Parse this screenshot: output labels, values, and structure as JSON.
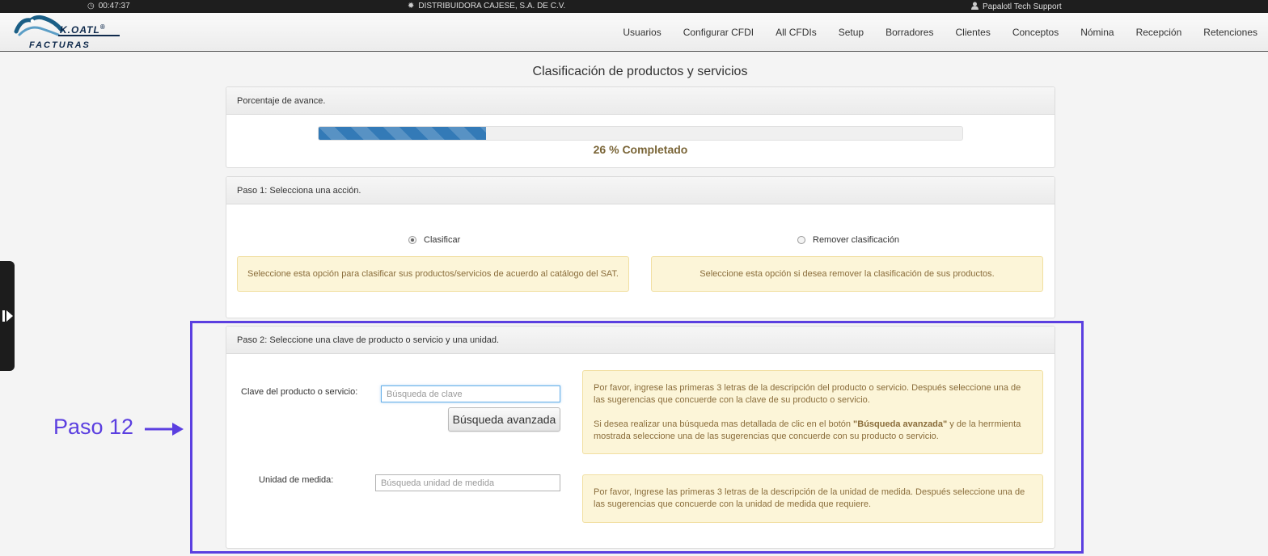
{
  "statusbar": {
    "time": "00:47:37",
    "company": "DISTRIBUIDORA CAJESE, S.A. DE C.V.",
    "user": "Papalotl Tech Support",
    "icons": [
      "clock-icon",
      "sun-icon",
      "user-icon"
    ]
  },
  "logo": {
    "top": "K.OATL",
    "reg": "®",
    "bottom": "FACTURAS"
  },
  "nav": {
    "items": [
      "Usuarios",
      "Configurar CFDI",
      "All CFDIs",
      "Setup",
      "Borradores",
      "Clientes",
      "Conceptos",
      "Nómina",
      "Recepción",
      "Retenciones"
    ]
  },
  "page": {
    "title": "Clasificación de productos y servicios"
  },
  "progress": {
    "heading": "Porcentaje de avance.",
    "percent": 26,
    "label": "26 % Completado"
  },
  "step1": {
    "heading": "Paso 1: Selecciona una acción.",
    "option_classify": "Clasificar",
    "option_remove": "Remover clasificación",
    "selected": "Clasificar",
    "info_classify": "Seleccione esta opción para clasificar sus productos/servicios de acuerdo al catálogo del SAT.",
    "info_remove": "Seleccione esta opción si desea remover la clasificación de sus productos."
  },
  "step2": {
    "heading": "Paso 2: Seleccione una clave de producto o servicio y una unidad.",
    "clave_label": "Clave del producto o servicio:",
    "clave_placeholder": "Búsqueda de clave",
    "advanced_button": "Búsqueda avanzada",
    "unidad_label": "Unidad de medida:",
    "unidad_placeholder": "Búsqueda unidad de medida",
    "help_clave_1": "Por favor, ingrese las primeras 3 letras de la descripción del producto o servicio. Después seleccione una de las sugerencias que concuerde con la clave de su producto o servicio.",
    "help_clave_2a": "Si desea realizar una búsqueda mas detallada de clic en el botón ",
    "help_clave_2b": "\"Búsqueda avanzada\"",
    "help_clave_2c": " y de la herrmienta mostrada seleccione una de las sugerencias que concuerde con su producto o servicio.",
    "help_unidad": "Por favor, Ingrese las primeras 3 letras de la descripción de la unidad de medida. Después seleccione una de las sugerencias que concuerde con la unidad de medida que requiere."
  },
  "annotation": {
    "label": "Paso 12",
    "color": "#5b3fe0"
  },
  "colors": {
    "progress": "#337ab7",
    "alert_bg": "#fcf5d8",
    "alert_text": "#8a6d3b",
    "completed_text": "#7a6537"
  }
}
